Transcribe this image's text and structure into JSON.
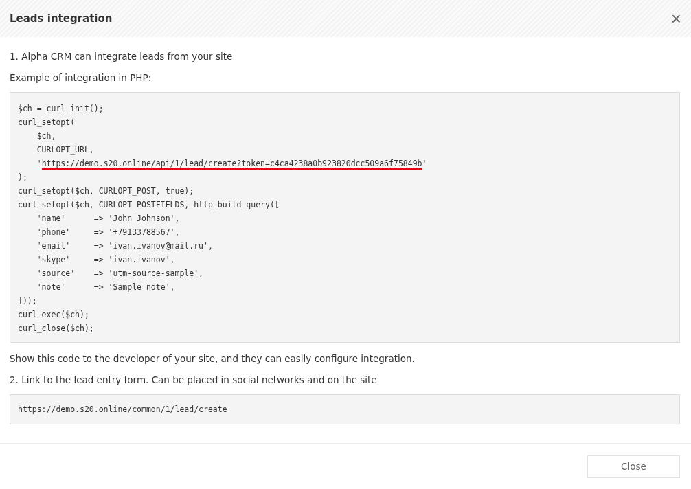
{
  "dialog": {
    "title": "Leads integration",
    "close_icon": "×"
  },
  "step_1": "1. Alpha CRM can integrate leads from your site",
  "example_label": "Example of integration in PHP:",
  "code": [
    {
      "kind": "plain",
      "text": "$ch = curl_init();"
    },
    {
      "kind": "plain",
      "text": "curl_setopt("
    },
    {
      "kind": "plain",
      "text": "    $ch,"
    },
    {
      "kind": "plain",
      "text": "    CURLOPT_URL,"
    },
    {
      "kind": "underlined",
      "before": "    '",
      "text": "https://demo.s20.online/api/1/lead/create?token=c4ca4238a0b923820dcc509a6f75849b",
      "after": "'"
    },
    {
      "kind": "plain",
      "text": ");"
    },
    {
      "kind": "plain",
      "text": "curl_setopt($ch, CURLOPT_POST, true);"
    },
    {
      "kind": "plain",
      "text": "curl_setopt($ch, CURLOPT_POSTFIELDS, http_build_query(["
    },
    {
      "kind": "plain",
      "text": "    'name'      => 'John Johnson',"
    },
    {
      "kind": "plain",
      "text": "    'phone'     => '+79133788567',"
    },
    {
      "kind": "plain",
      "text": "    'email'     => 'ivan.ivanov@mail.ru',"
    },
    {
      "kind": "plain",
      "text": "    'skype'     => 'ivan.ivanov',"
    },
    {
      "kind": "plain",
      "text": "    'source'    => 'utm-source-sample',"
    },
    {
      "kind": "plain",
      "text": "    'note'      => 'Sample note',"
    },
    {
      "kind": "plain",
      "text": "]));"
    },
    {
      "kind": "plain",
      "text": "curl_exec($ch);"
    },
    {
      "kind": "plain",
      "text": "curl_close($ch);"
    }
  ],
  "developer_note": "Show this code to the developer of your site, and they can easily configure integration.",
  "step_2": "2. Link to the lead entry form. Can be placed in social networks and on the site",
  "form_link": "https://demo.s20.online/common/1/lead/create",
  "buttons": [
    "Close"
  ]
}
